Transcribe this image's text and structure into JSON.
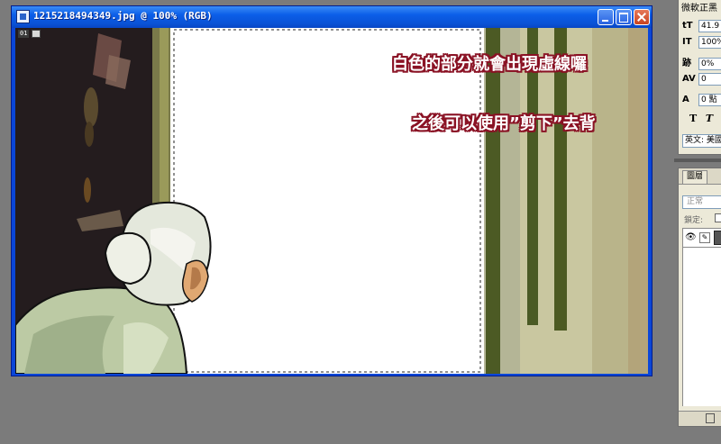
{
  "document_window": {
    "title": "1215218494349.jpg @ 100% (RGB)",
    "nav_chip_label": "01",
    "annotations": [
      "白色的部分就會出現虛線囉",
      "之後可以使用”剪下”去背"
    ],
    "icons": {
      "app": "photoshop-document-icon",
      "minimize": "minimize-icon",
      "maximize": "maximize-icon",
      "close": "close-icon"
    },
    "colors": {
      "annotation_fill": "#ffffff",
      "annotation_outline": "#8a1224",
      "titlebar": "#0a52d6"
    }
  },
  "character_panel": {
    "font_name": "微軟正黑",
    "size_value": "41.9",
    "vertical_scale": "100%",
    "tracking_value": "0%",
    "kerning_value": "0",
    "baseline_value": "0 點",
    "style_bold": "T",
    "style_italic": "T",
    "language": "英文: 美國"
  },
  "layers_panel": {
    "tab_label": "圖層",
    "blend_mode": "正常",
    "lock_label": "鎖定:"
  }
}
